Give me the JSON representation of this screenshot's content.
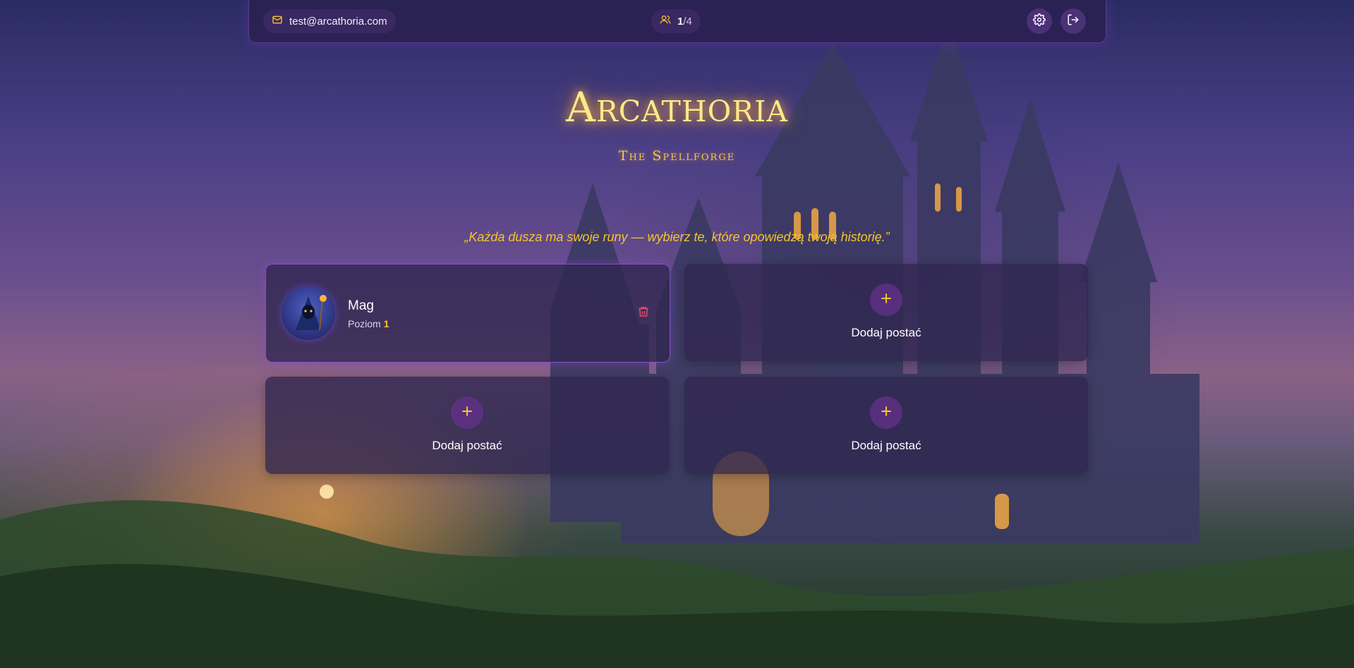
{
  "header": {
    "email": "test@arcathoria.com",
    "character_count": "1",
    "character_max": "/4",
    "mail_icon": "mail-icon",
    "users_icon": "users-icon",
    "settings_icon": "gear-icon",
    "logout_icon": "logout-icon"
  },
  "brand": {
    "title": "Arcathoria",
    "subtitle": "The Spellforge"
  },
  "quote": "„Każda dusza ma swoje runy — wybierz te, które opowiedzą twoją historię.”",
  "slots": {
    "character": {
      "name": "Mag",
      "level_label": "Poziom",
      "level": "1",
      "avatar_icon": "wizard-avatar",
      "delete_icon": "trash-icon"
    },
    "empty_label": "Dodaj postać",
    "add_icon": "plus-icon"
  },
  "colors": {
    "accent_gold": "#f5c52c",
    "panel": "#30264f",
    "border_purple": "#a05ae6",
    "delete_red": "#e0506a"
  }
}
